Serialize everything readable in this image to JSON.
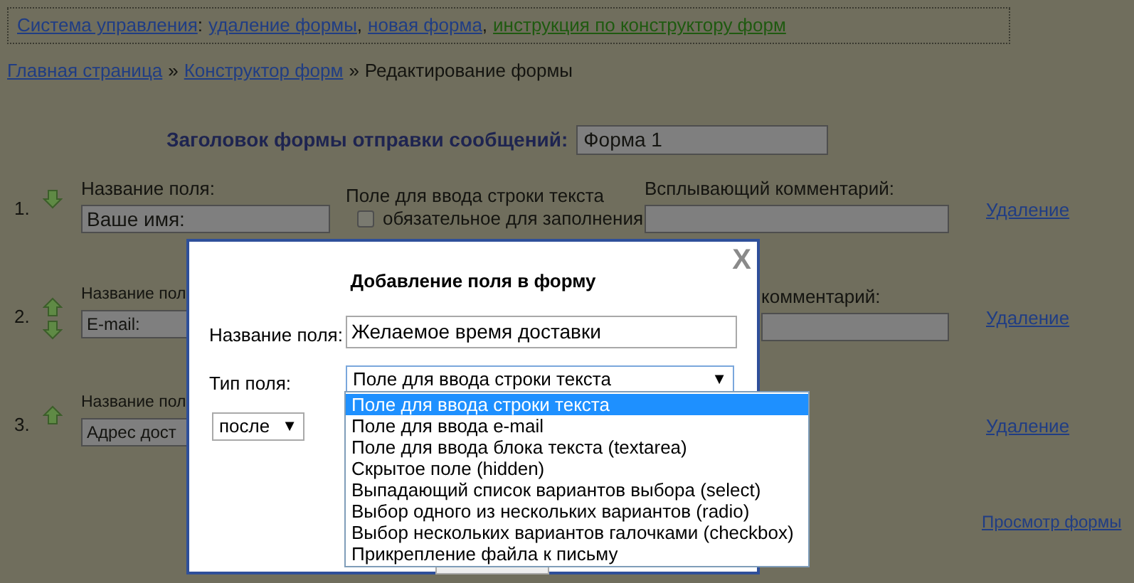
{
  "top_nav": [
    {
      "label": "Система управления",
      "kind": "link",
      "after": ":"
    },
    {
      "label": "удаление формы",
      "kind": "link",
      "after": ","
    },
    {
      "label": "новая форма",
      "kind": "link",
      "after": ","
    },
    {
      "label": "инструкция по конструктору форм",
      "kind": "guide"
    }
  ],
  "breadcrumb": [
    {
      "label": "Главная страница",
      "link": true,
      "after": "»"
    },
    {
      "label": "Конструктор форм",
      "link": true,
      "after": "»"
    },
    {
      "label": "Редактирование формы",
      "link": false
    }
  ],
  "form_title": {
    "label": "Заголовок формы отправки сообщений:",
    "value": "Форма 1"
  },
  "fields": [
    {
      "number": "1.",
      "move_up": false,
      "move_down": true,
      "name_label": "Название поля:",
      "name_value": "Ваше имя:",
      "type_label": "Поле для ввода строки текста",
      "required": {
        "label": "обязательное для заполнения",
        "checked": false
      },
      "comment_label": "Всплывающий комментарий:",
      "delete": "Удаление"
    },
    {
      "number": "2.",
      "move_up": true,
      "move_down": true,
      "name_label": "Название пол",
      "name_value": "E-mail:",
      "comment_label": "комментарий:",
      "delete": "Удаление"
    },
    {
      "number": "3.",
      "move_up": true,
      "move_down": false,
      "name_label": "Название пол",
      "name_value": "Адрес дост",
      "delete": "Удаление"
    }
  ],
  "preview_link": "Просмотр формы",
  "modal": {
    "close": "X",
    "title": "Добавление поля в форму",
    "name_label": "Название поля:",
    "name_value": "Желаемое время доставки",
    "type_label": "Тип поля:",
    "type_value": "Поле для ввода строки текста",
    "type_arrow": "▼",
    "position_value": "после",
    "position_arrow": "▼",
    "options": [
      {
        "label": "Поле для ввода строки текста",
        "selected": true
      },
      {
        "label": "Поле для ввода e-mail",
        "selected": false
      },
      {
        "label": "Поле для ввода блока текста (textarea)",
        "selected": false
      },
      {
        "label": "Скрытое поле (hidden)",
        "selected": false
      },
      {
        "label": "Выпадающий список вариантов выбора (select)",
        "selected": false
      },
      {
        "label": "Выбор одного из нескольких вариантов (radio)",
        "selected": false
      },
      {
        "label": "Выбор нескольких вариантов галочками (checkbox)",
        "selected": false
      },
      {
        "label": "Прикрепление файла к письму",
        "selected": false
      }
    ]
  }
}
